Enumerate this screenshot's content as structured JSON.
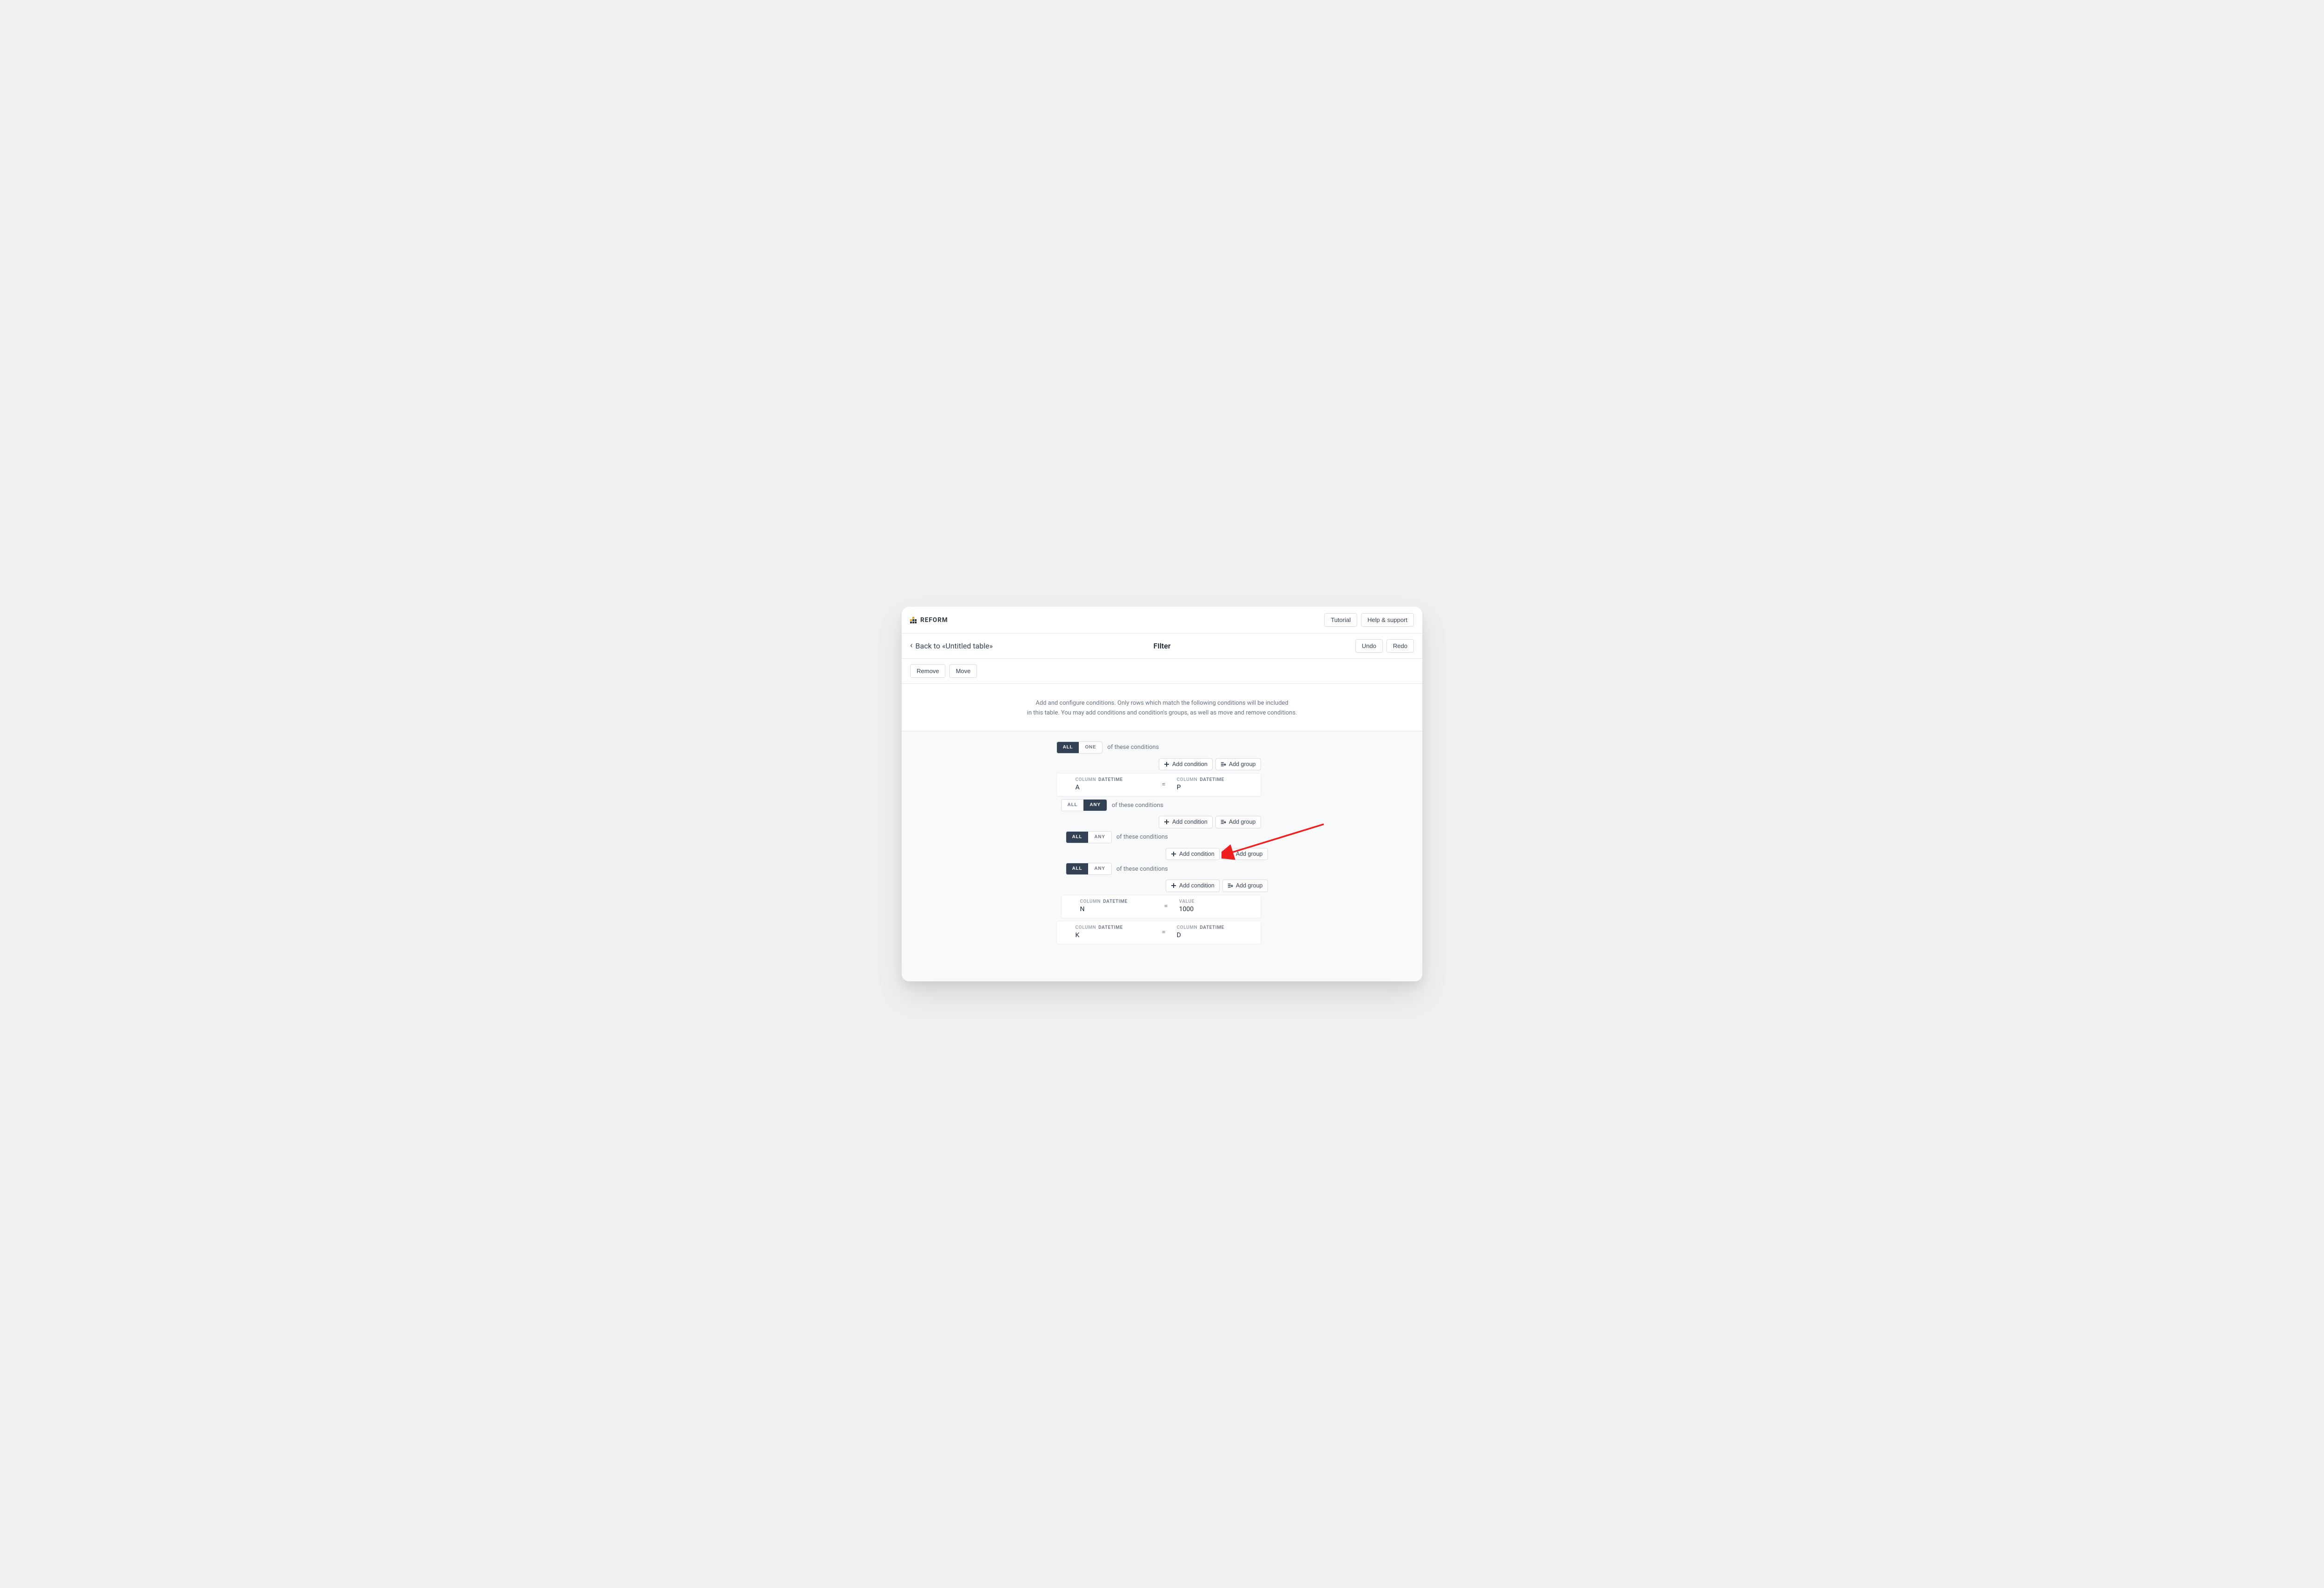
{
  "brand": {
    "name": "REFORM"
  },
  "topbar": {
    "tutorial": "Tutorial",
    "help": "Help & support"
  },
  "subbar": {
    "back": "Back to «Untitled table»",
    "title": "FIlter",
    "undo": "Undo",
    "redo": "Redo"
  },
  "toolbar": {
    "remove": "Remove",
    "move": "Move"
  },
  "desc": {
    "line1": "Add and configure conditions. Only rows which match the following conditions will be included",
    "line2": "in this table. You may add conditions and condition's groups, as well as move and remove conditions."
  },
  "ui": {
    "all": "ALL",
    "one": "ONE",
    "any": "ANY",
    "of": "of these conditions",
    "add_cond": "Add condition",
    "add_group": "Add group",
    "column": "COLUMN",
    "value": "VALUE",
    "datetime": "DATETIME",
    "eq": "="
  },
  "conditions": {
    "c1": {
      "left": "A",
      "right": "P"
    },
    "c2": {
      "left": "N",
      "right": "1000"
    },
    "c3": {
      "left": "K",
      "right": "D"
    }
  }
}
